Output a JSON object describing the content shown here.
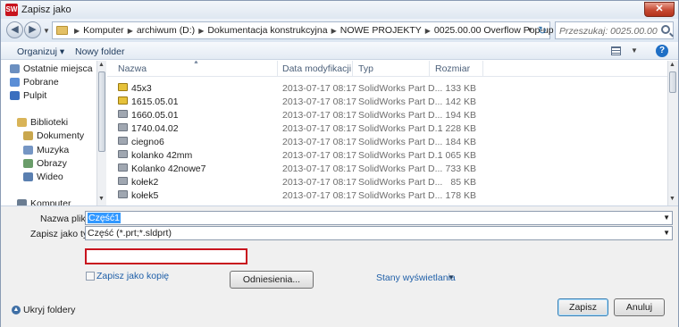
{
  "title": "Zapisz jako",
  "app_icon_label": "SW",
  "close_label": "✕",
  "address": {
    "crumbs": [
      "Komputer",
      "archiwum (D:)",
      "Dokumentacja konstrukcyjna",
      "NOWE PROJEKTY",
      "0025.00.00 Overflow Pop-up"
    ],
    "search_placeholder": "Przeszukaj: 0025.00.00 ..."
  },
  "toolbar": {
    "organize": "Organizuj ▾",
    "new_folder": "Nowy folder"
  },
  "nav": {
    "items": [
      {
        "label": "Ostatnie miejsca",
        "icon": "recent-places-icon",
        "color": "#6b8fc0"
      },
      {
        "label": "Pobrane",
        "icon": "downloads-folder-icon",
        "color": "#5b8ed6"
      },
      {
        "label": "Pulpit",
        "icon": "desktop-icon",
        "color": "#3b6fbf"
      },
      {
        "label": "Biblioteki",
        "icon": "libraries-icon",
        "color": "#d9b458"
      },
      {
        "label": "Dokumenty",
        "icon": "documents-icon",
        "color": "#c9a74e"
      },
      {
        "label": "Muzyka",
        "icon": "music-icon",
        "color": "#7596c4"
      },
      {
        "label": "Obrazy",
        "icon": "pictures-icon",
        "color": "#6a9d6a"
      },
      {
        "label": "Wideo",
        "icon": "video-icon",
        "color": "#5a7fb0"
      },
      {
        "label": "Komputer",
        "icon": "computer-icon",
        "color": "#6b7d92"
      }
    ]
  },
  "columns": {
    "name": "Nazwa",
    "date": "Data modyfikacji",
    "type": "Typ",
    "size": "Rozmiar"
  },
  "files": [
    {
      "name": "45x3",
      "date": "2013-07-17 08:17",
      "type": "SolidWorks Part D...",
      "size": "133 KB",
      "icon": "assembly-part-icon"
    },
    {
      "name": "1615.05.01",
      "date": "2013-07-17 08:17",
      "type": "SolidWorks Part D...",
      "size": "142 KB",
      "icon": "assembly-part-icon"
    },
    {
      "name": "1660.05.01",
      "date": "2013-07-17 08:17",
      "type": "SolidWorks Part D...",
      "size": "194 KB",
      "icon": "part-icon"
    },
    {
      "name": "1740.04.02",
      "date": "2013-07-17 08:17",
      "type": "SolidWorks Part D...",
      "size": "1 228 KB",
      "icon": "part-icon"
    },
    {
      "name": "ciegno6",
      "date": "2013-07-17 08:17",
      "type": "SolidWorks Part D...",
      "size": "184 KB",
      "icon": "part-icon"
    },
    {
      "name": "kolanko 42mm",
      "date": "2013-07-17 08:17",
      "type": "SolidWorks Part D...",
      "size": "1 065 KB",
      "icon": "part-icon"
    },
    {
      "name": "Kolanko 42nowe7",
      "date": "2013-07-17 08:17",
      "type": "SolidWorks Part D...",
      "size": "733 KB",
      "icon": "part-icon"
    },
    {
      "name": "kołek2",
      "date": "2013-07-17 08:17",
      "type": "SolidWorks Part D...",
      "size": "85 KB",
      "icon": "part-icon"
    },
    {
      "name": "kołek5",
      "date": "2013-07-17 08:17",
      "type": "SolidWorks Part D...",
      "size": "178 KB",
      "icon": "part-icon"
    }
  ],
  "form": {
    "filename_label": "Nazwa pliku:",
    "filename_value": "Część1",
    "filetype_label": "Zapisz jako typ:",
    "filetype_value": "Część (*.prt;*.sldprt)",
    "save_copy_label": "Zapisz jako kopię",
    "references_button": "Odniesienia...",
    "display_states": "Stany wyświetlania",
    "hide_folders": "Ukryj foldery",
    "save_button": "Zapisz",
    "cancel_button": "Anuluj"
  }
}
